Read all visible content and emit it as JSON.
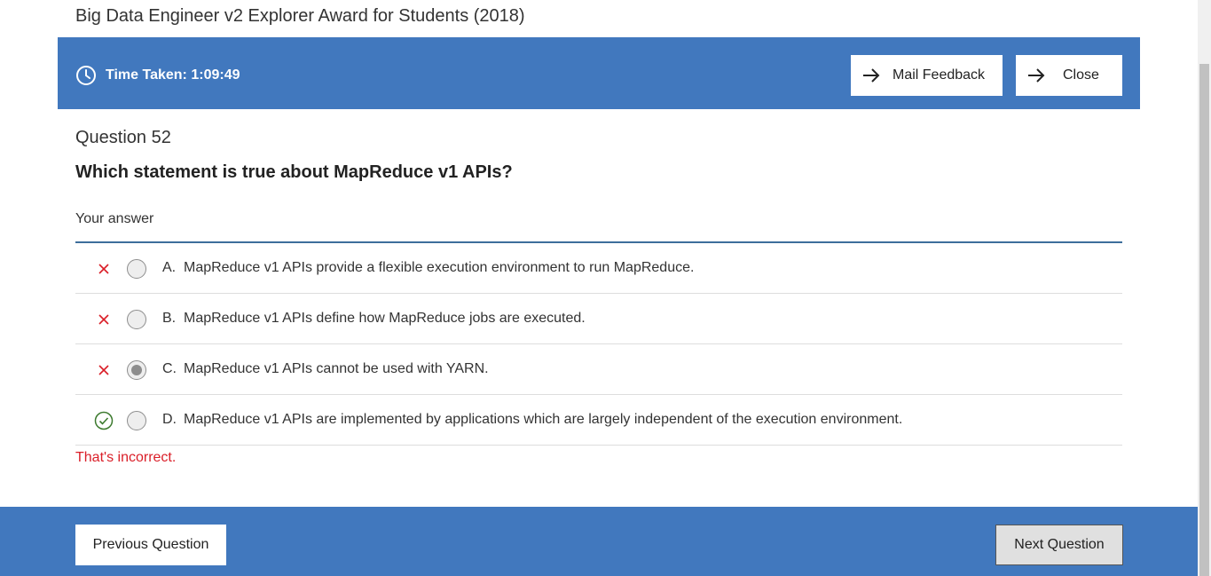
{
  "exam": {
    "title": "Big Data Engineer v2 Explorer Award for Students (2018)"
  },
  "header": {
    "time_label": "Time Taken:",
    "time_value": "1:09:49",
    "mail_feedback_label": "Mail Feedback",
    "close_label": "Close",
    "bar_color": "#4178be"
  },
  "question": {
    "number_label": "Question 52",
    "text": "Which statement is true about MapReduce v1 APIs?",
    "your_answer_label": "Your answer",
    "options": [
      {
        "letter": "A.",
        "text": "MapReduce v1 APIs provide a flexible execution environment to run MapReduce.",
        "mark": "x-icon",
        "selected": false
      },
      {
        "letter": "B.",
        "text": "MapReduce v1 APIs define how MapReduce jobs are executed.",
        "mark": "x-icon",
        "selected": false
      },
      {
        "letter": "C.",
        "text": "MapReduce v1 APIs cannot be used with YARN.",
        "mark": "x-icon",
        "selected": true
      },
      {
        "letter": "D.",
        "text": "MapReduce v1 APIs are implemented by applications which are largely independent of the execution environment.",
        "mark": "check-circle-icon",
        "selected": false
      }
    ],
    "feedback": "That's incorrect.",
    "feedback_color": "#da1e28"
  },
  "footer": {
    "previous_label": "Previous Question",
    "next_label": "Next Question"
  }
}
